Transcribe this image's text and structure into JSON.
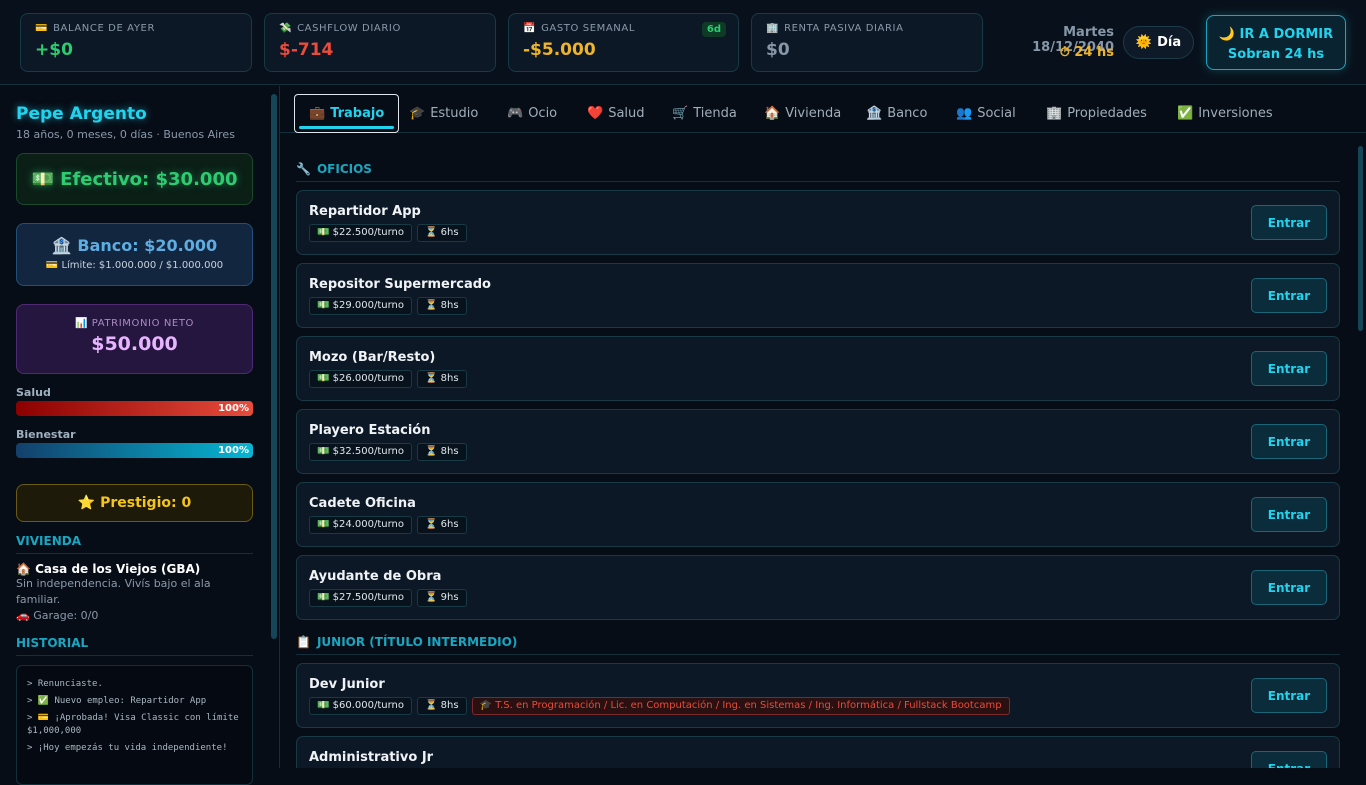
{
  "stats": [
    {
      "icon": "💳",
      "label": "BALANCE DE AYER",
      "value": "+$0",
      "color": "#2ecc71"
    },
    {
      "icon": "💸",
      "label": "CASHFLOW DIARIO",
      "value": "$-714",
      "color": "#e74c3c"
    },
    {
      "icon": "📅",
      "label": "GASTO SEMANAL",
      "value": "-$5.000",
      "color": "#f0b429",
      "badge": "6d"
    },
    {
      "icon": "🏢",
      "label": "RENTA PASIVA DIARIA",
      "value": "$0",
      "color": "#8797a8"
    }
  ],
  "clock": {
    "date": "Martes 18/12/2040",
    "hours": "⏱ 24 hs",
    "period": "Día",
    "period_icon": "🌞"
  },
  "sleep": {
    "label": "🌙 IR A DORMIR",
    "sub": "Sobran 24 hs"
  },
  "player": {
    "name": "Pepe Argento",
    "info": "18 años, 0 meses, 0 días · Buenos Aires",
    "cash": "💵 Efectivo: $30.000",
    "bank": "🏦 Banco: $20.000",
    "limit": "💳 Límite: $1.000.000 / $1.000.000",
    "net_label": "📊 PATRIMONIO NETO",
    "net_value": "$50.000",
    "health_label": "Salud",
    "health": "100%",
    "wellbeing_label": "Bienestar",
    "wellbeing": "100%",
    "prestige": "⭐ Prestigio: 0"
  },
  "housing": {
    "title": "VIVIENDA",
    "name": "🏠 Casa de los Viejos (GBA)",
    "desc": "Sin independencia. Vivís bajo el ala familiar.",
    "garage": "🚗 Garage: 0/0"
  },
  "history": {
    "title": "HISTORIAL",
    "items": [
      "> Renunciaste.",
      "> ✅ Nuevo empleo: Repartidor App",
      "> 💳 ¡Aprobada! Visa Classic con límite $1,000,000",
      "> ¡Hoy empezás tu vida independiente!"
    ]
  },
  "tabs": [
    {
      "icon": "💼",
      "label": "Trabajo"
    },
    {
      "icon": "🎓",
      "label": "Estudio"
    },
    {
      "icon": "🎮",
      "label": "Ocio"
    },
    {
      "icon": "❤️",
      "label": "Salud"
    },
    {
      "icon": "🛒",
      "label": "Tienda"
    },
    {
      "icon": "🏠",
      "label": "Vivienda"
    },
    {
      "icon": "🏦",
      "label": "Banco"
    },
    {
      "icon": "👥",
      "label": "Social"
    },
    {
      "icon": "🏢",
      "label": "Propiedades"
    },
    {
      "icon": "✅",
      "label": "Inversiones"
    }
  ],
  "sections": [
    {
      "icon": "🔧",
      "title": "OFICIOS",
      "jobs": [
        {
          "name": "Repartidor App",
          "pay": "💵 $22.500/turno",
          "hours": "⏳ 6hs"
        },
        {
          "name": "Repositor Supermercado",
          "pay": "💵 $29.000/turno",
          "hours": "⏳ 8hs"
        },
        {
          "name": "Mozo (Bar/Resto)",
          "pay": "💵 $26.000/turno",
          "hours": "⏳ 8hs"
        },
        {
          "name": "Playero Estación",
          "pay": "💵 $32.500/turno",
          "hours": "⏳ 8hs"
        },
        {
          "name": "Cadete Oficina",
          "pay": "💵 $24.000/turno",
          "hours": "⏳ 6hs"
        },
        {
          "name": "Ayudante de Obra",
          "pay": "💵 $27.500/turno",
          "hours": "⏳ 9hs"
        }
      ]
    },
    {
      "icon": "📋",
      "title": "JUNIOR (TÍTULO INTERMEDIO)",
      "jobs": [
        {
          "name": "Dev Junior",
          "pay": "💵 $60.000/turno",
          "hours": "⏳ 8hs",
          "req": "🎓 T.S. en Programación / Lic. en Computación / Ing. en Sistemas / Ing. Informática / Fullstack Bootcamp"
        },
        {
          "name": "Administrativo Jr",
          "pay": "",
          "hours": ""
        }
      ]
    }
  ],
  "enter_label": "Entrar"
}
